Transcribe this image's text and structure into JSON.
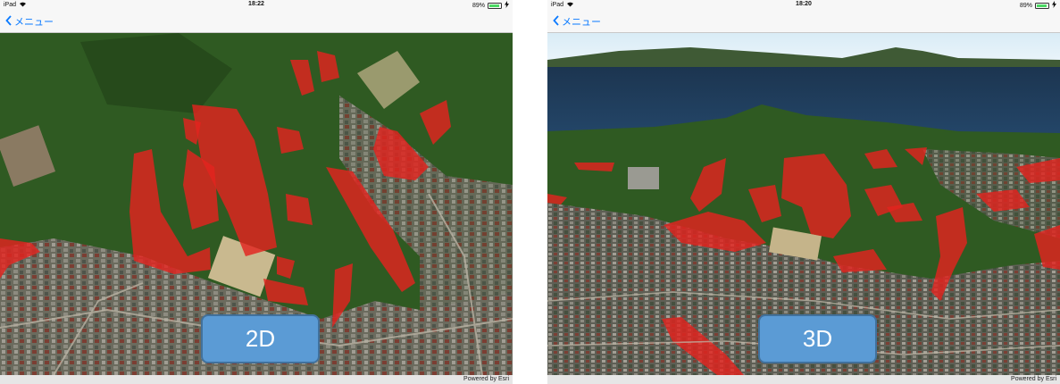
{
  "panels": [
    {
      "status": {
        "device": "iPad",
        "time": "18:22",
        "battery": "89%",
        "battery_level": 0.89
      },
      "nav": {
        "back_label": "メニュー"
      },
      "badge": "2D",
      "attribution": "Powered by Esri",
      "view": "2d-aerial-map-with-red-hazard-overlay"
    },
    {
      "status": {
        "device": "iPad",
        "time": "18:20",
        "battery": "89%",
        "battery_level": 0.89
      },
      "nav": {
        "back_label": "メニュー"
      },
      "badge": "3D",
      "attribution": "Powered by Esri",
      "view": "3d-terrain-scene-with-red-hazard-overlay"
    }
  ],
  "colors": {
    "accent": "#0a7aff",
    "hazard": "#e3231f",
    "badge_fill": "#5b9bd5",
    "badge_border": "#41719c",
    "forest": "#2f5a22",
    "sea": "#1c3550"
  },
  "icons": [
    "wifi-icon",
    "chevron-left-icon",
    "battery-icon",
    "charging-icon"
  ]
}
